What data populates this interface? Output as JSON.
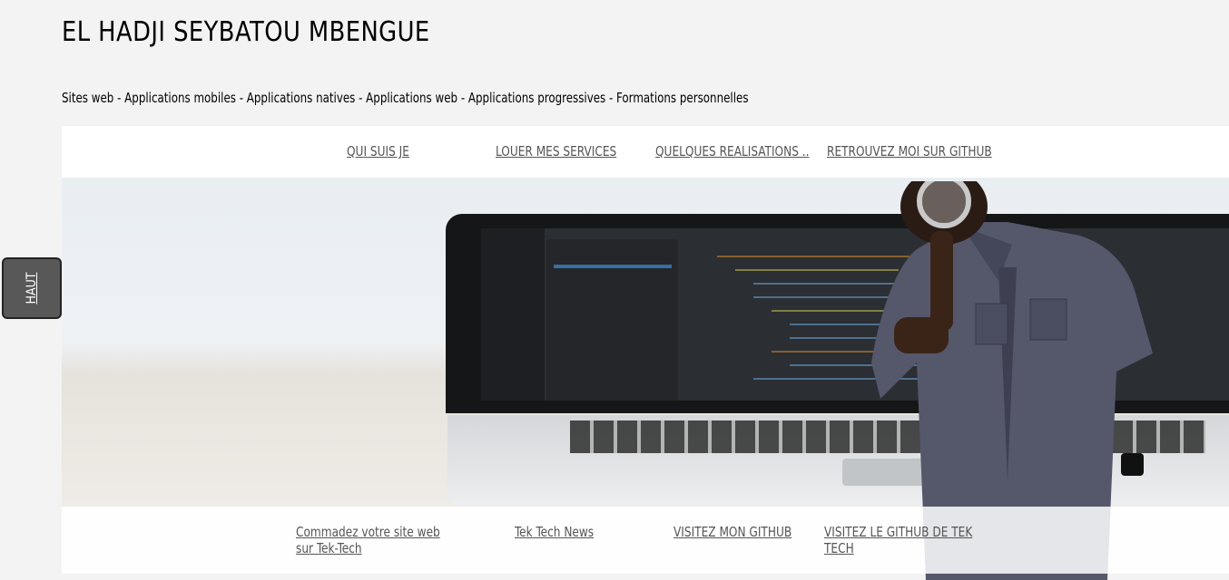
{
  "header": {
    "site_title": "EL HADJI SEYBATOU MBENGUE",
    "tagline": "Sites web - Applications mobiles - Applications natives - Applications web - Applications progressives - Formations personnelles"
  },
  "nav": {
    "items": [
      {
        "label": "QUI SUIS JE"
      },
      {
        "label": "LOUER MES SERVICES"
      },
      {
        "label": "QUELQUES REALISATIONS .."
      },
      {
        "label": "RETROUVEZ MOI SUR GITHUB"
      }
    ]
  },
  "scroll_top": {
    "label": "HAUT"
  },
  "footer": {
    "links": [
      {
        "label": "Commadez votre site web sur Tek-Tech"
      },
      {
        "label": "Tek Tech News"
      },
      {
        "label": "VISITEZ MON GITHUB"
      },
      {
        "label": "VISITEZ LE GITHUB DE TEK TECH"
      }
    ]
  },
  "colors": {
    "page_background": "#f3f3f3",
    "nav_background": "#ffffff",
    "link_color": "#555555",
    "haut_button": "#585858"
  }
}
